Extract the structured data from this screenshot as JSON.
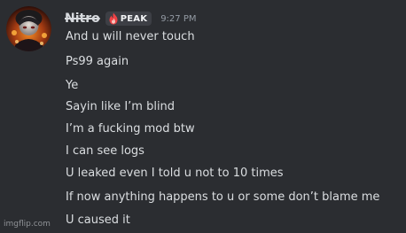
{
  "message": {
    "username": "Nitro",
    "badge": {
      "label": "PEAK",
      "icon": "flame-icon",
      "color": "#ed4245"
    },
    "timestamp": "9:27 PM",
    "avatar": "avatar-image",
    "lines": [
      "And u will never touch",
      "Ps99 again",
      "Ye",
      "Sayin like I’m blind",
      "I’m a fucking mod btw",
      "I can see logs",
      "U leaked even I told u not to 10 times",
      "If now anything happens to u or some don’t blame me",
      "U caused it"
    ]
  },
  "watermark": "imgflip.com",
  "colors": {
    "background": "#2b2d31",
    "text": "#dbdee1",
    "muted": "#949ba4"
  }
}
